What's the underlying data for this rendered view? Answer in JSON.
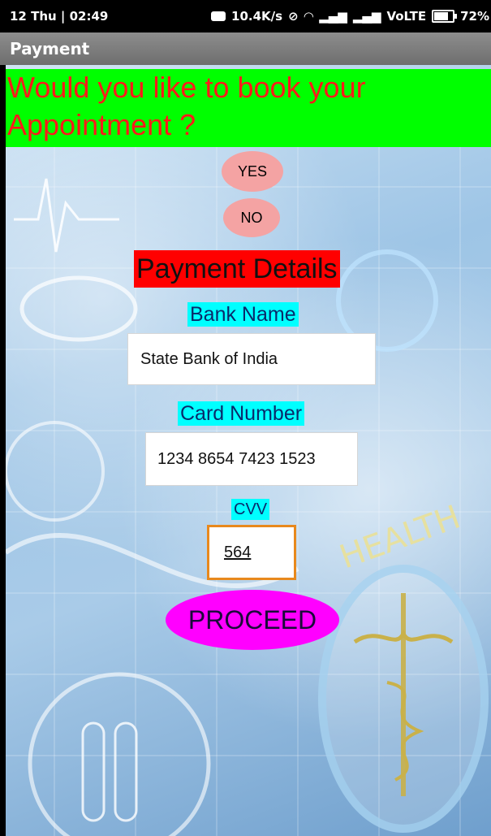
{
  "status_bar": {
    "time": "12 Thu | 02:49",
    "net_speed": "10.4K/s",
    "network": "VoLTE",
    "battery": "72%"
  },
  "app_bar": {
    "title": "Payment"
  },
  "question": "Would you like to book your Appointment ?",
  "buttons": {
    "yes": "YES",
    "no": "NO",
    "proceed": "PROCEED"
  },
  "payment": {
    "heading": "Payment Details",
    "bank_label": "Bank Name",
    "bank_value": "State Bank of India",
    "card_label": "Card Number",
    "card_value": "1234 8654 7423 1523",
    "cvv_label": "CVV",
    "cvv_value": "564"
  },
  "background_text": "HEALTH",
  "colors": {
    "banner_bg": "#00ff00",
    "banner_text": "#ff1a1a",
    "label_bg": "#00ffff",
    "heading_bg": "#ff0000",
    "proceed_bg": "#ff00ff",
    "oval_btn_bg": "#f4a3a3",
    "cvv_border": "#e8891d"
  }
}
